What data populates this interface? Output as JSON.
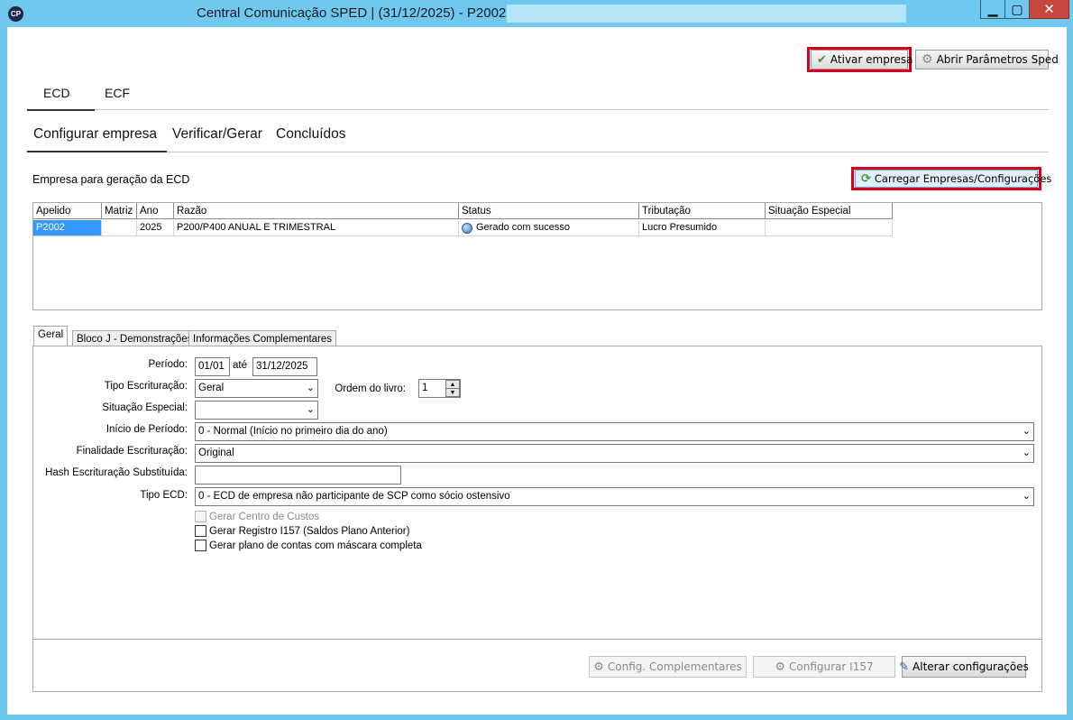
{
  "window": {
    "title": "Central Comunicação SPED | (31/12/2025) - P2002 -",
    "app_icon": "CP",
    "controls": {
      "minimize": "▁",
      "maximize": "▢",
      "close": "✕"
    }
  },
  "toolbar": {
    "ativar_label": "Ativar empresa",
    "abrir_label": "Abrir Parâmetros Sped",
    "ativar_icon": "check-icon",
    "abrir_icon": "gear-icon"
  },
  "main_tabs": [
    {
      "label": "ECD",
      "active": true
    },
    {
      "label": "ECF",
      "active": false
    }
  ],
  "sub_tabs": [
    {
      "label": "Configurar empresa",
      "active": true
    },
    {
      "label": "Verificar/Gerar",
      "active": false
    },
    {
      "label": "Concluídos",
      "active": false
    }
  ],
  "empresa_section": {
    "title": "Empresa para geração da ECD",
    "carregar_label": "Carregar Empresas/Configurações",
    "carregar_icon": "refresh-icon"
  },
  "grid": {
    "columns": [
      "Apelido",
      "Matriz",
      "Ano",
      "Razão",
      "Status",
      "Tributação",
      "Situação Especial"
    ],
    "rows": [
      {
        "apelido": "P2002",
        "matriz": "",
        "ano": "2025",
        "razao": "P200/P400 ANUAL E TRIMESTRAL",
        "status": "Gerado com sucesso",
        "tributacao": "Lucro Presumido",
        "situacao": ""
      }
    ]
  },
  "config_tabs": [
    {
      "label": "Geral",
      "active": true
    },
    {
      "label": "Bloco J - Demonstrações",
      "active": false
    },
    {
      "label": "Informações Complementares",
      "active": false
    }
  ],
  "form": {
    "periodo_label": "Período:",
    "periodo_inicio": "01/01",
    "ate_label": "até",
    "periodo_fim": "31/12/2025",
    "tipo_escrituracao_label": "Tipo Escrituração:",
    "tipo_escrituracao_value": "Geral",
    "ordem_livro_label": "Ordem do livro:",
    "ordem_livro_value": "1",
    "situacao_especial_label": "Situação Especial:",
    "situacao_especial_value": "",
    "inicio_periodo_label": "Início de Período:",
    "inicio_periodo_value": "0 - Normal (Início no primeiro dia do ano)",
    "finalidade_label": "Finalidade Escrituração:",
    "finalidade_value": "Original",
    "hash_label": "Hash Escrituração Substituída:",
    "hash_value": "",
    "tipo_ecd_label": "Tipo ECD:",
    "tipo_ecd_value": "0 - ECD de empresa não participante de SCP como sócio ostensivo",
    "chk_centro_custos": "Gerar Centro de Custos",
    "chk_i157": "Gerar Registro I157 (Saldos Plano Anterior)",
    "chk_mascara": "Gerar plano de contas com máscara completa"
  },
  "bottom_buttons": {
    "config_complementares": "Config. Complementares",
    "configurar_i157": "Configurar I157",
    "alterar_configuracoes": "Alterar configurações"
  }
}
